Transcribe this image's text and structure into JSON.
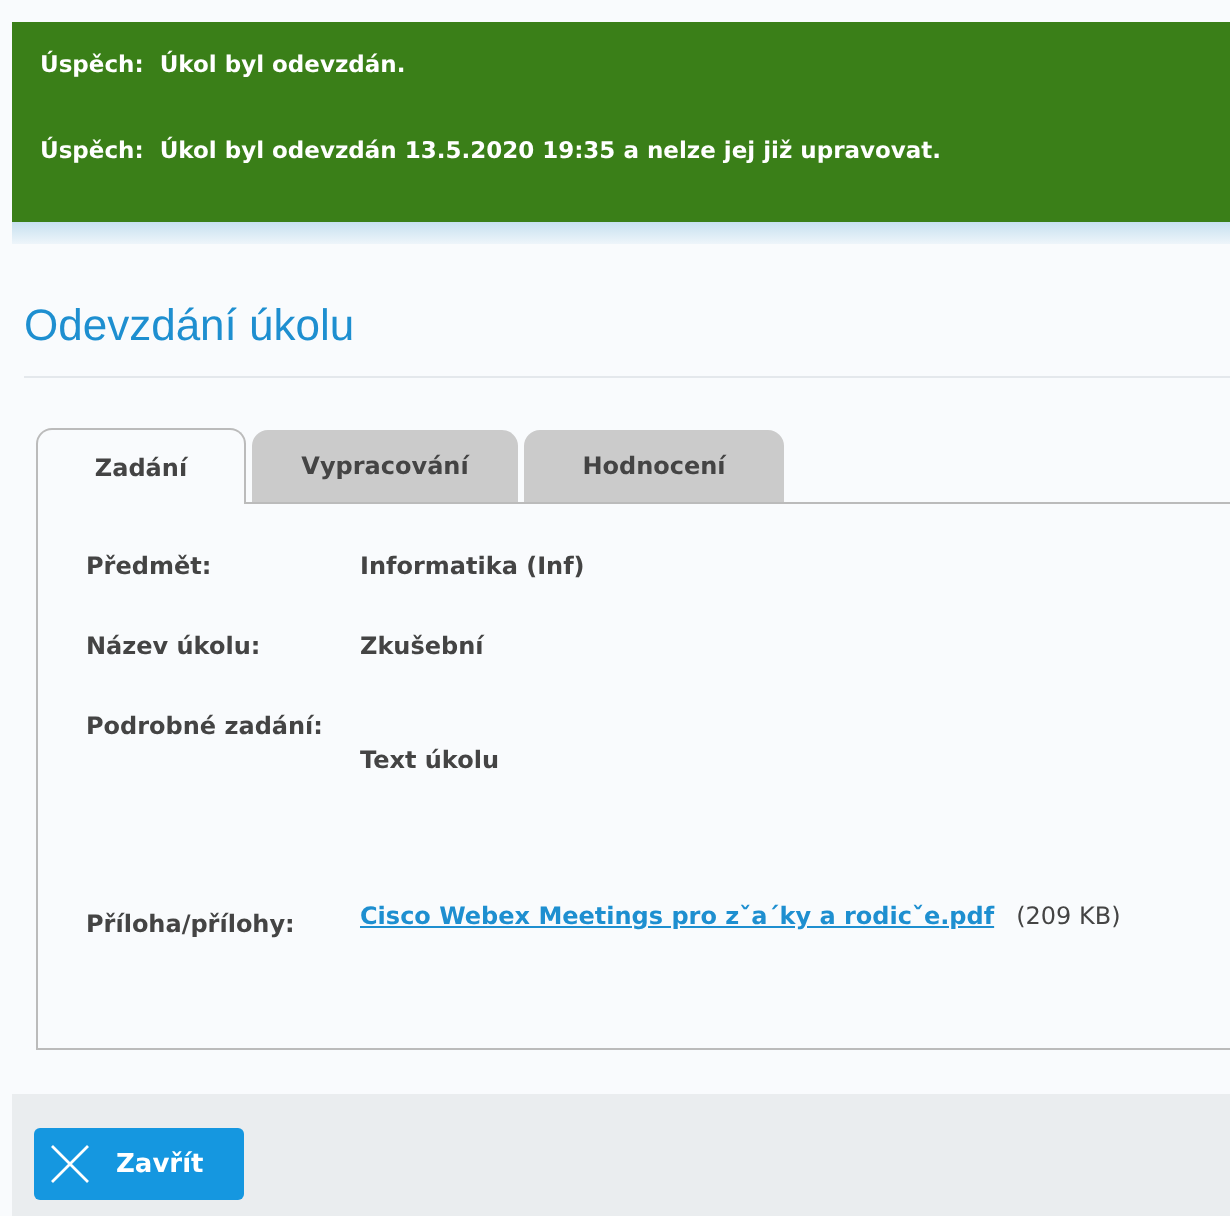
{
  "messages": [
    {
      "label": "Úspěch:",
      "text": "Úkol byl odevzdán."
    },
    {
      "label": "Úspěch:",
      "text": "Úkol byl odevzdán 13.5.2020 19:35 a nelze jej již upravovat."
    }
  ],
  "title": "Odevzdání úkolu",
  "tabs": [
    {
      "label": "Zadání",
      "selected": true
    },
    {
      "label": "Vypracování",
      "selected": false
    },
    {
      "label": "Hodnocení",
      "selected": false
    }
  ],
  "fields": [
    {
      "kind": "text",
      "label": "Předmět:",
      "value": "Informatika (Inf)"
    },
    {
      "kind": "text",
      "label": "Název úkolu:",
      "value": "Zkušební"
    },
    {
      "kind": "long",
      "label": "Podrobné zadání:",
      "value": "Text úkolu"
    },
    {
      "kind": "attachment",
      "label": "Příloha/přílohy:",
      "link": "Cisco Webex Meetings pro zˇa´ky a rodicˇe.pdf",
      "size": "(209 KB)"
    }
  ],
  "close_button": "Zavřít"
}
